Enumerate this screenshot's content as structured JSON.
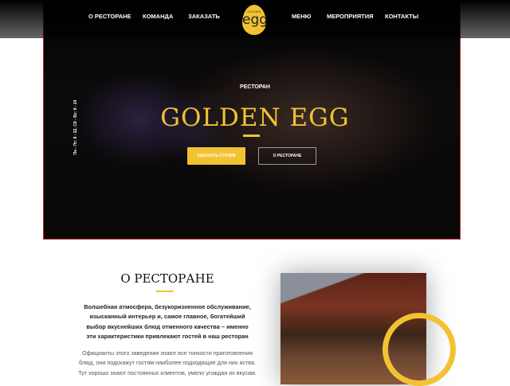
{
  "nav": {
    "left": [
      "О РЕСТОРАНЕ",
      "КОМАНДА",
      "ЗАКАЗАТЬ"
    ],
    "right": [
      "МЕНЮ",
      "МЕРОПРИЯТИЯ",
      "КОНТАКТЫ"
    ]
  },
  "logo": {
    "small": "GOLDEN",
    "big": "egg"
  },
  "hero": {
    "hours": "Пн - Пт: 8 - 22, Сб - Вс: 9 - 24",
    "subtitle": "РЕСТОРАН",
    "title": "GOLDEN EGG",
    "book_button": "ЗАКАЗАТЬ СТОЛИК",
    "about_button": "О РЕСТОРАНЕ"
  },
  "about": {
    "heading": "О РЕСТОРАНЕ",
    "lead": "Волшебная атмосфера, безукоризненное обслуживание, изысканный интерьер и, самое главное, богатейший выбор вкуснейших блюд отменного качества – именно эти характеристики привлекают гостей в наш ресторан",
    "body": "Официанты этого заведения знают все тонкости приготовления блюд, они подскажут гостям наиболее подходящие для них яства. Тут хорошо знают постоянных клиентов, умело угождая их вкусам."
  },
  "colors": {
    "accent": "#f1c232",
    "border": "#c0272d"
  }
}
